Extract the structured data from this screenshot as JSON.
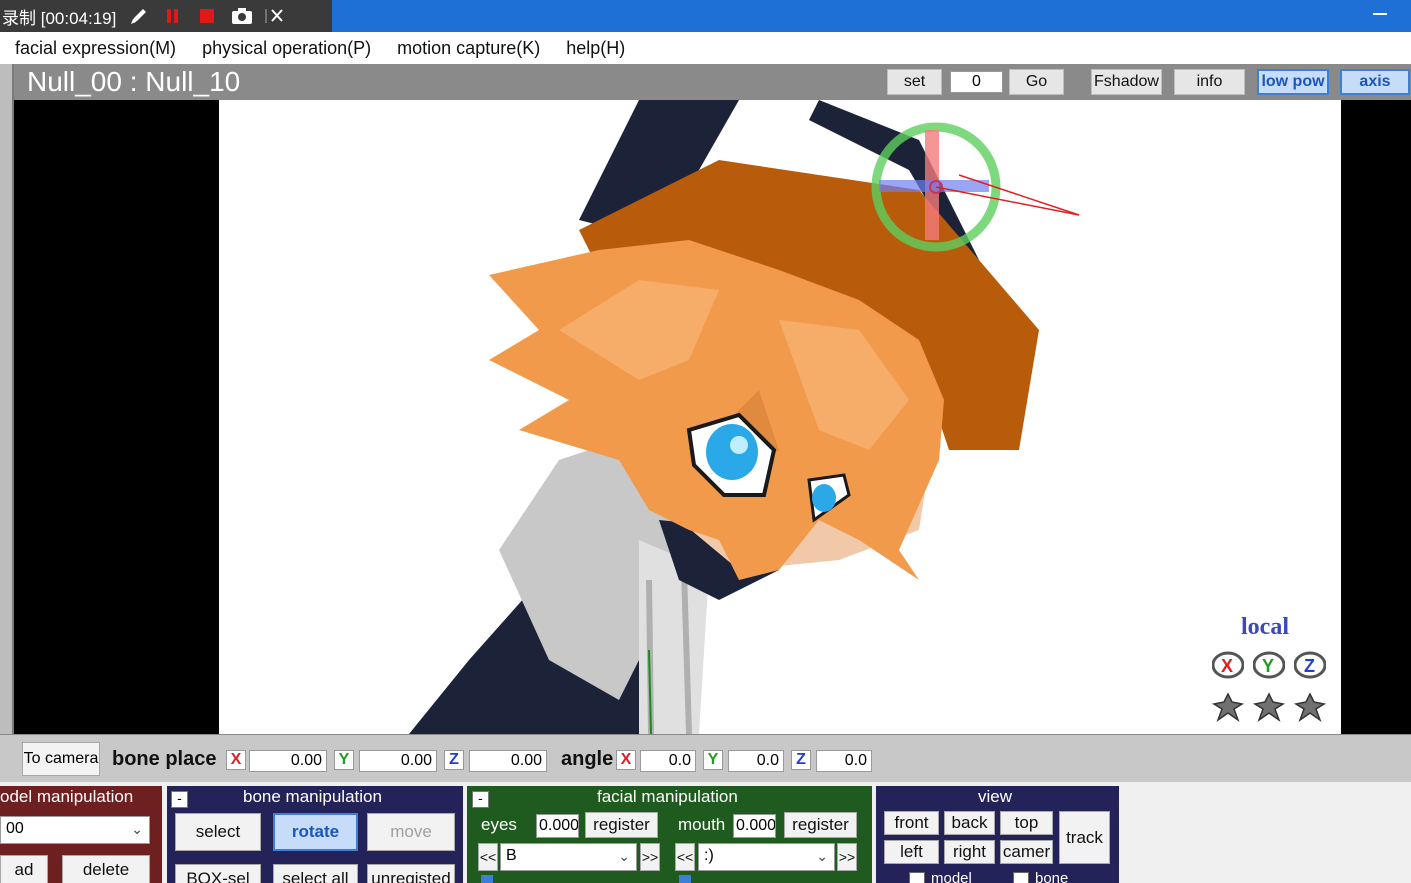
{
  "recorder": {
    "label": "录制 [00:04:19]"
  },
  "menu": [
    "facial expression(M)",
    "physical operation(P)",
    "motion capture(K)",
    "help(H)"
  ],
  "header": {
    "bone_name": "Null_00 : Null_10",
    "set_label": "set",
    "frame_value": "0",
    "go_label": "Go",
    "fshadow_label": "Fshadow",
    "info_label": "info",
    "lowpow_label": "low pow",
    "axis_label": "axis"
  },
  "viewport": {
    "local_label": "local"
  },
  "bone_place": {
    "to_camera_label": "To camera",
    "place_label": "bone place",
    "angle_label": "angle",
    "x_tag": "X",
    "y_tag": "Y",
    "z_tag": "Z",
    "pos_x": "0.00",
    "pos_y": "0.00",
    "pos_z": "0.00",
    "ang_x": "0.0",
    "ang_y": "0.0",
    "ang_z": "0.0"
  },
  "model_panel": {
    "title": "odel manipulation",
    "select_value": "00",
    "load_label": "ad",
    "delete_label": "delete"
  },
  "bone_panel": {
    "title": "bone manipulation",
    "select_label": "select",
    "rotate_label": "rotate",
    "move_label": "move",
    "boxsel_label": "BOX-sel",
    "selectall_label": "select all",
    "unregisted_label": "unregisted"
  },
  "facial_panel": {
    "title": "facial manipulation",
    "eyes_label": "eyes",
    "eyes_value": "0.000",
    "eyes_register": "register",
    "mouth_label": "mouth",
    "mouth_value": "0.000",
    "mouth_register": "register",
    "prev_label": "<<",
    "next_label": ">>",
    "eyes_select": "B",
    "mouth_select": ":)"
  },
  "view_panel": {
    "title": "view",
    "front_label": "front",
    "back_label": "back",
    "top_label": "top",
    "track_label": "track",
    "left_label": "left",
    "right_label": "right",
    "camera_label": "camer",
    "model_check_label": "model",
    "bone_check_label": "bone"
  },
  "colors": {
    "title_blue": "#1e6fd6",
    "model_panel": "#6e2020",
    "bone_panel": "#23235a",
    "facial_panel": "#1f5a1f",
    "view_panel": "#23235a",
    "hair_orange": "#f0a060",
    "hat_brown": "#b85c0c",
    "eye_blue": "#2aa8e8"
  }
}
